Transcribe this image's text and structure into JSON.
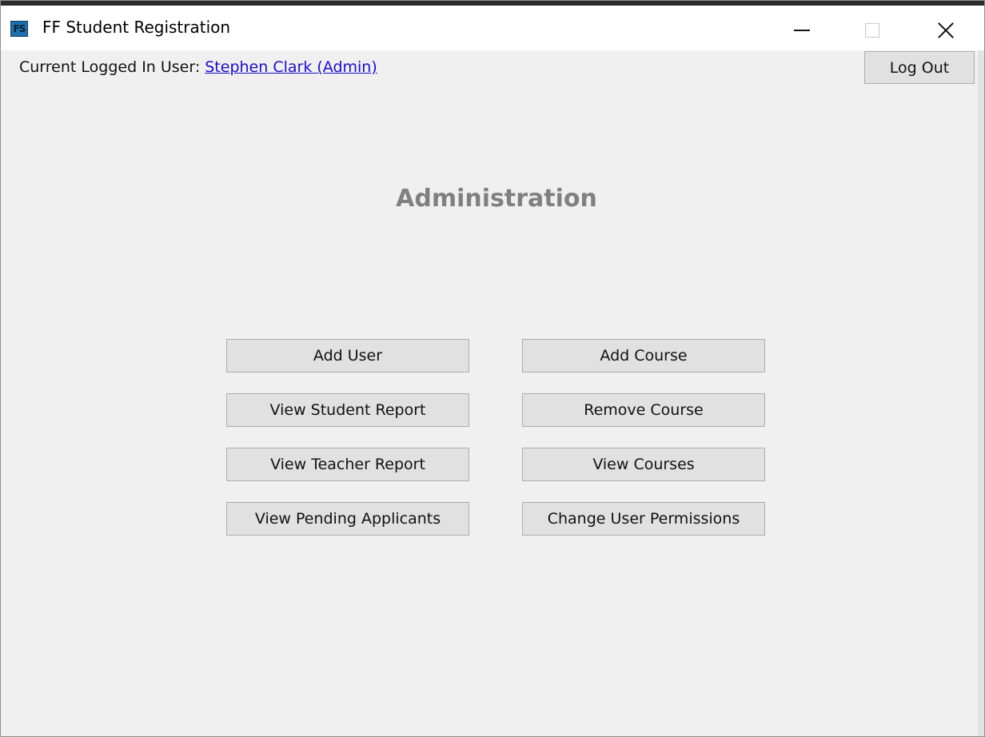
{
  "window": {
    "title": "FF Student Registration",
    "icon_text": "FS"
  },
  "header": {
    "user_label": "Current Logged In User:",
    "user_name": "Stephen Clark (Admin)",
    "logout_label": "Log Out"
  },
  "main": {
    "heading": "Administration",
    "buttons": {
      "add_user": "Add User",
      "add_course": "Add Course",
      "view_student_report": "View Student Report",
      "remove_course": "Remove Course",
      "view_teacher_report": "View Teacher Report",
      "view_courses": "View Courses",
      "view_pending_applicants": "View Pending Applicants",
      "change_user_permissions": "Change User Permissions"
    }
  },
  "icons": {
    "app": "app-icon",
    "minimize": "minimize-icon",
    "maximize": "maximize-icon",
    "close": "close-icon"
  }
}
